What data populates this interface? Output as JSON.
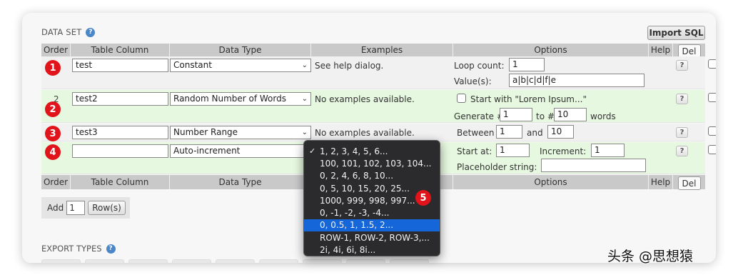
{
  "data_set": {
    "title": "DATA SET",
    "import_sql_label": "Import SQL"
  },
  "headers": {
    "order": "Order",
    "table_column": "Table Column",
    "data_type": "Data Type",
    "examples": "Examples",
    "options": "Options",
    "help": "Help",
    "del": "Del"
  },
  "rows": [
    {
      "badge": "1",
      "column": "test",
      "data_type": "Constant",
      "example": "See help dialog.",
      "loop_count_label": "Loop count:",
      "loop_count_value": "1",
      "values_label": "Value(s):",
      "values_value": "a|b|c|d|f|e",
      "help_label": "?"
    },
    {
      "badge": "2",
      "order": "2",
      "column": "test2",
      "data_type": "Random Number of Words",
      "example": "No examples available.",
      "start_with_label": "Start with \"Lorem Ipsum...\"",
      "generate_label": "Generate #",
      "generate_from": "1",
      "to_label": "to #",
      "generate_to": "10",
      "words_label": "words",
      "help_label": "?"
    },
    {
      "badge": "3",
      "column": "test3",
      "data_type": "Number Range",
      "example": "No examples available.",
      "between_label": "Between",
      "between_from": "1",
      "and_label": "and",
      "between_to": "10",
      "help_label": "?"
    },
    {
      "badge": "4",
      "column": "",
      "data_type": "Auto-increment",
      "start_at_label": "Start at:",
      "start_at_value": "1",
      "increment_label": "Increment:",
      "increment_value": "1",
      "placeholder_label": "Placeholder string:",
      "placeholder_value": "",
      "help_label": "?"
    }
  ],
  "add_rows": {
    "add_label": "Add",
    "count": "1",
    "button_label": "Row(s)"
  },
  "export_types": {
    "title": "EXPORT TYPES"
  },
  "dropdown": {
    "items": [
      "1, 2, 3, 4, 5, 6...",
      "100, 101, 102, 103, 104...",
      "0, 2, 4, 6, 8, 10...",
      "0, 5, 10, 15, 20, 25...",
      "1000, 999, 998, 997...",
      "0, -1, -2, -3, -4...",
      "0, 0.5, 1, 1.5, 2...",
      "ROW-1, ROW-2, ROW-3,...",
      "2i, 4i, 6i, 8i..."
    ],
    "checked_index": 0,
    "highlighted_index": 6,
    "check_mark": "✓",
    "badge": "5"
  },
  "watermark": "头条 @思想猿",
  "colors": {
    "badge": "#e0141a",
    "row_green": "#e6f8df",
    "header_grey": "#c9c9c9",
    "dropdown_bg": "#2b2b2d",
    "dropdown_highlight": "#1566d8",
    "help_icon": "#4a86c8"
  }
}
